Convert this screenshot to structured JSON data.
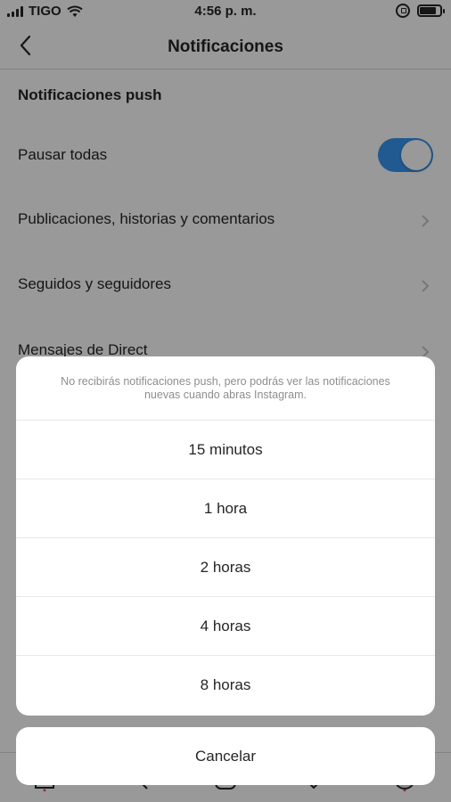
{
  "status_bar": {
    "carrier": "TIGO",
    "time": "4:56 p. m."
  },
  "header": {
    "title": "Notificaciones"
  },
  "settings": {
    "section_title": "Notificaciones push",
    "pause_all": {
      "label": "Pausar todas",
      "enabled": true
    },
    "items": [
      {
        "label": "Publicaciones, historias y comentarios"
      },
      {
        "label": "Seguidos y seguidores"
      },
      {
        "label": "Mensajes de Direct"
      }
    ]
  },
  "action_sheet": {
    "message": "No recibirás notificaciones push, pero podrás ver las notificaciones nuevas cuando abras Instagram.",
    "options": [
      {
        "label": "15 minutos"
      },
      {
        "label": "1 hora"
      },
      {
        "label": "2 horas"
      },
      {
        "label": "4 horas"
      },
      {
        "label": "8 horas"
      }
    ],
    "cancel_label": "Cancelar"
  },
  "colors": {
    "accent": "#3897f0",
    "text": "#262626",
    "muted": "#8e8e8e",
    "notification_dot": "#ed4956"
  },
  "icons": {
    "tabs": [
      "home-icon",
      "search-icon",
      "add-post-icon",
      "activity-icon",
      "profile-icon"
    ]
  }
}
